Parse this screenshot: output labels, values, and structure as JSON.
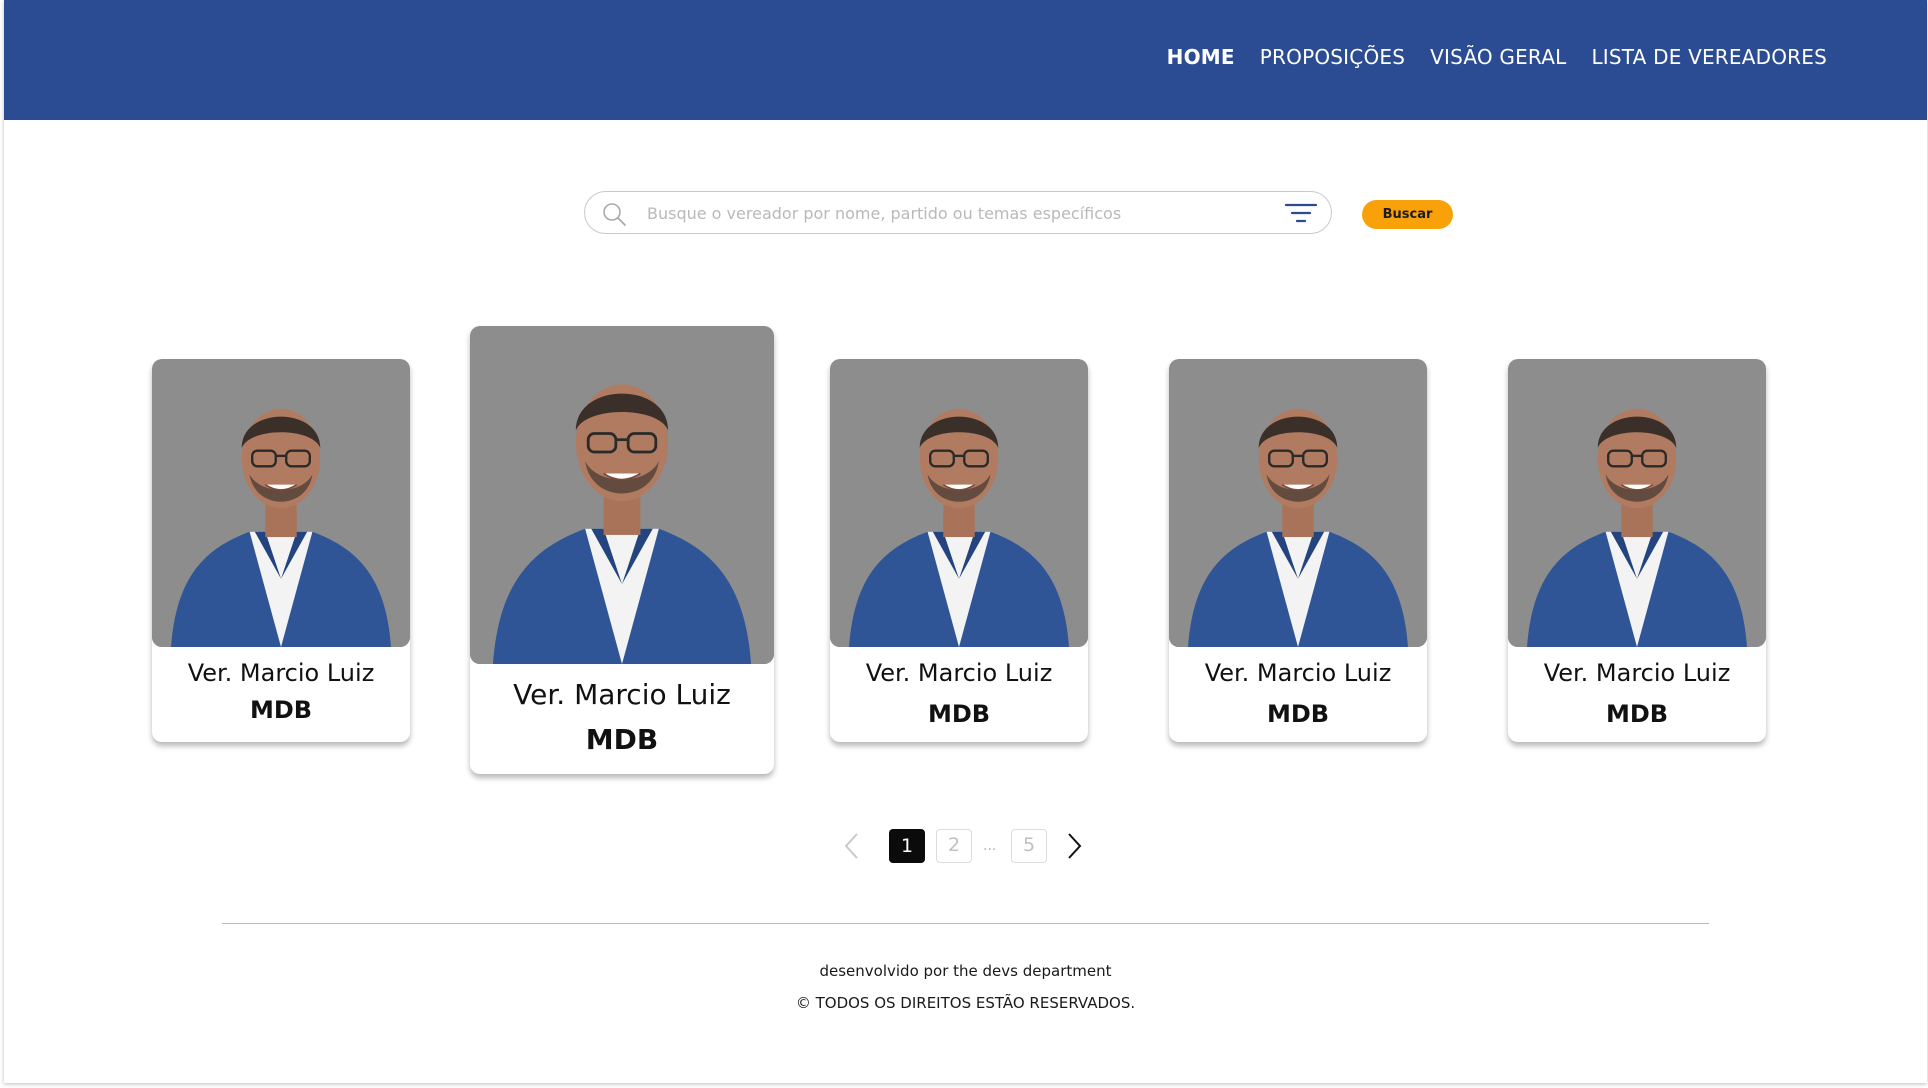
{
  "nav": {
    "items": [
      {
        "label": "HOME",
        "active": true
      },
      {
        "label": "PROPOSIÇÕES",
        "active": false
      },
      {
        "label": "VISÃO GERAL",
        "active": false
      },
      {
        "label": "LISTA DE VEREADORES",
        "active": false
      }
    ]
  },
  "search": {
    "placeholder": "Busque o vereador por nome, partido ou temas específicos",
    "value": "",
    "button_label": "Buscar",
    "search_icon": "search-icon",
    "filter_icon": "filter-icon"
  },
  "cards": [
    {
      "name": "Ver. Marcio Luiz",
      "party": "MDB",
      "highlighted": false
    },
    {
      "name": "Ver. Marcio Luiz",
      "party": "MDB",
      "highlighted": true
    },
    {
      "name": "Ver. Marcio Luiz",
      "party": "MDB",
      "highlighted": false
    },
    {
      "name": "Ver. Marcio Luiz",
      "party": "MDB",
      "highlighted": false
    },
    {
      "name": "Ver. Marcio Luiz",
      "party": "MDB",
      "highlighted": false
    }
  ],
  "pagination": {
    "current": "1",
    "next": "2",
    "ellipsis": "...",
    "last": "5",
    "prev_icon": "chevron-left-icon",
    "next_icon": "chevron-right-icon"
  },
  "footer": {
    "credit": "desenvolvido por the devs department",
    "rights": "© TODOS OS DIREITOS ESTÃO RESERVADOS."
  },
  "colors": {
    "header_bg": "#2b4c93",
    "accent_button": "#f9a10b",
    "photo_bg": "#8d8d8d",
    "blazer": "#2f5597"
  }
}
